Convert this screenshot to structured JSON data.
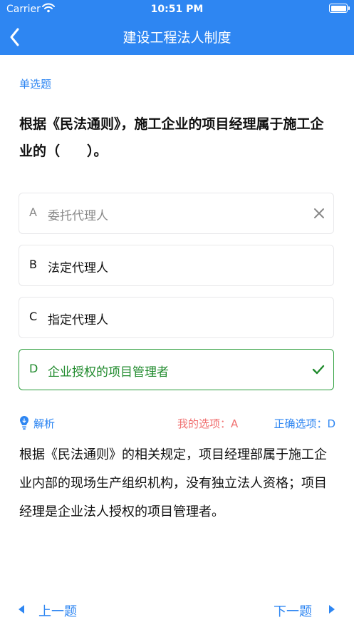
{
  "status_bar": {
    "carrier": "Carrier",
    "time": "10:51 PM"
  },
  "nav": {
    "title": "建设工程法人制度",
    "back_icon": "chevron-left-icon"
  },
  "question": {
    "type": "单选题",
    "text": "根据《民法通则》，施工企业的项目经理属于施工企业的（　　）。"
  },
  "options": [
    {
      "letter": "A",
      "text": "委托代理人",
      "state": "wrong"
    },
    {
      "letter": "B",
      "text": "法定代理人",
      "state": "normal"
    },
    {
      "letter": "C",
      "text": "指定代理人",
      "state": "normal"
    },
    {
      "letter": "D",
      "text": "企业授权的项目管理者",
      "state": "correct"
    }
  ],
  "analysis": {
    "label": "解析",
    "my_answer": "我的选项：A",
    "correct_answer": "正确选项：D",
    "text": "根据《民法通则》的相关规定，项目经理部属于施工企业内部的现场生产组织机构，没有独立法人资格；项目经理是企业法人授权的项目管理者。"
  },
  "footer": {
    "prev_label": "上一题",
    "next_label": "下一题"
  },
  "colors": {
    "primary": "#2e86f2",
    "correct": "#1f8a2c",
    "wrong": "#8a8a8a",
    "my_answer": "#f07070"
  }
}
